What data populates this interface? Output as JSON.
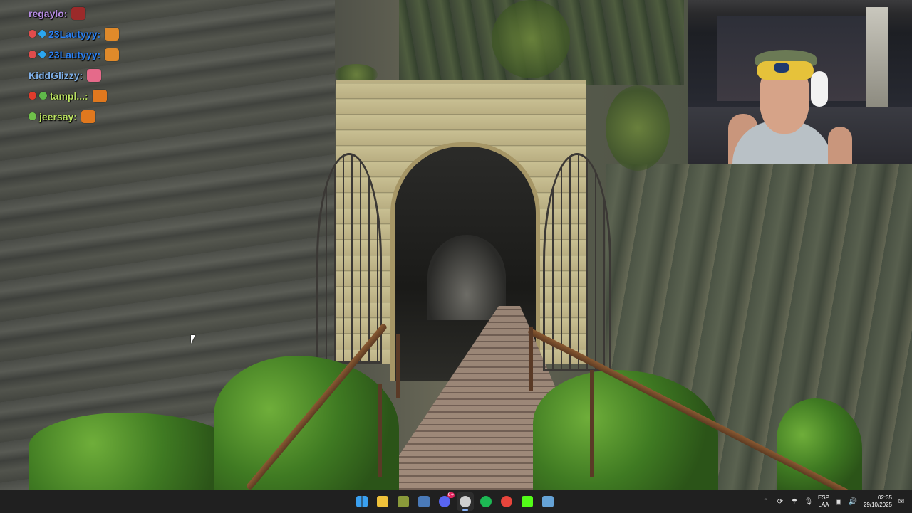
{
  "chat": {
    "messages": [
      {
        "username": "regaylo:",
        "name_color": "#b48be0",
        "badges": [],
        "emote": "pinata-emote",
        "emote_color": "#9b2a2a"
      },
      {
        "username": "23Lautyyy:",
        "name_color": "#2a7ff0",
        "badges": [
          {
            "color": "#e04c4c",
            "shape": "circle"
          },
          {
            "color": "#2ba6f0",
            "shape": "diamond"
          }
        ],
        "emote": "hamburger-emote",
        "emote_color": "#e08a2a"
      },
      {
        "username": "23Lautyyy:",
        "name_color": "#2a7ff0",
        "badges": [
          {
            "color": "#e04c4c",
            "shape": "circle"
          },
          {
            "color": "#2ba6f0",
            "shape": "diamond"
          }
        ],
        "emote": "hamburger-emote",
        "emote_color": "#e08a2a"
      },
      {
        "username": "KiddGlizzy:",
        "name_color": "#7fb0e8",
        "badges": [],
        "emote": "pink-cat-emote",
        "emote_color": "#e56a8a"
      },
      {
        "username": "tampl...:",
        "name_color": "#b9e060",
        "badges": [
          {
            "color": "#e03c2c",
            "shape": "circle"
          },
          {
            "color": "#5fb84a",
            "shape": "circle"
          }
        ],
        "emote": "briefcase-emote",
        "emote_color": "#e0781e"
      },
      {
        "username": "jeersay:",
        "name_color": "#b9e060",
        "badges": [
          {
            "color": "#6fc04a",
            "shape": "circle"
          }
        ],
        "emote": "briefcase-emote",
        "emote_color": "#e0781e"
      }
    ]
  },
  "taskbar": {
    "apps": [
      {
        "name": "windows-start-icon",
        "color": "#3aa0f0",
        "active": false,
        "notification": ""
      },
      {
        "name": "file-explorer-icon",
        "color": "#f0c23a",
        "active": false,
        "notification": ""
      },
      {
        "name": "game-app-icon",
        "color": "#8a9a3a",
        "active": false,
        "notification": ""
      },
      {
        "name": "steam-icon",
        "color": "#4a7ab8",
        "active": false,
        "notification": ""
      },
      {
        "name": "discord-icon",
        "color": "#5865f2",
        "active": false,
        "notification": "9+"
      },
      {
        "name": "obs-icon",
        "color": "#cfcfcf",
        "active": true,
        "notification": ""
      },
      {
        "name": "spotify-icon",
        "color": "#1db954",
        "active": false,
        "notification": ""
      },
      {
        "name": "chrome-icon",
        "color": "#e8453c",
        "active": false,
        "notification": ""
      },
      {
        "name": "kick-icon",
        "color": "#53fc18",
        "active": false,
        "notification": ""
      },
      {
        "name": "steam-alt-icon",
        "color": "#66a3d6",
        "active": false,
        "notification": ""
      }
    ],
    "tray": {
      "language_top": "ESP",
      "language_bottom": "LAA",
      "time": "02:35",
      "date": "29/10/2025"
    }
  }
}
